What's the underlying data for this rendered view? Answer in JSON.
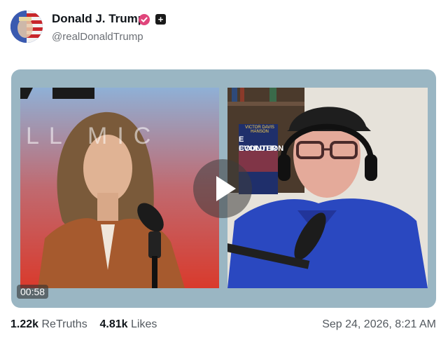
{
  "post": {
    "author_name": "Donald J. Trump",
    "author_handle": "@realDonaldTrump",
    "retruths_count": "1.22k",
    "retruths_label": "ReTruths",
    "likes_count": "4.81k",
    "likes_label": "Likes",
    "timestamp": "Sep 24, 2026, 8:21 AM"
  },
  "media": {
    "duration": "00:58",
    "left_backdrop_text": "LL   MIC",
    "book_title_line1": "E COUNTER",
    "book_title_line2": "EVOLUTION",
    "book_top_text": "VICTOR DAVIS HANSON"
  },
  "icons": [
    "verified-badge-icon",
    "plus-icon",
    "play-icon"
  ],
  "colors": {
    "card_background": "#9ab6c3",
    "verified": "#e0457b",
    "text_primary": "#0f1419",
    "text_secondary": "#53595f"
  }
}
